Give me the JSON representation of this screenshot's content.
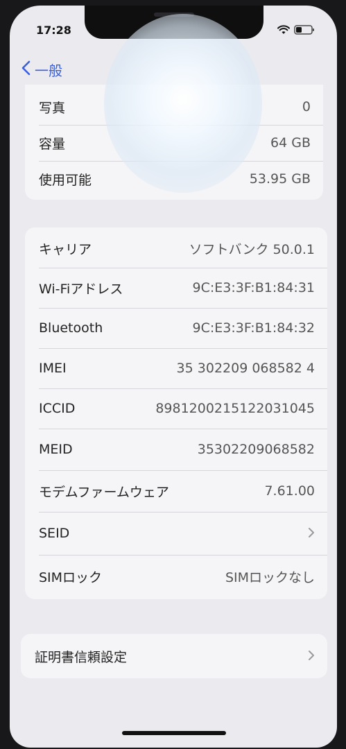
{
  "status_bar": {
    "time": "17:28"
  },
  "nav": {
    "back_label": "一般"
  },
  "storage_section": {
    "rows": [
      {
        "label": "写真",
        "value": "0"
      },
      {
        "label": "容量",
        "value": "64 GB"
      },
      {
        "label": "使用可能",
        "value": "53.95 GB"
      }
    ]
  },
  "network_section": {
    "rows": [
      {
        "label": "キャリア",
        "value": "ソフトバンク 50.0.1"
      },
      {
        "label": "Wi-Fiアドレス",
        "value": "9C:E3:3F:B1:84:31"
      },
      {
        "label": "Bluetooth",
        "value": "9C:E3:3F:B1:84:32"
      },
      {
        "label": "IMEI",
        "value": "35 302209 068582 4"
      },
      {
        "label": "ICCID",
        "value": "8981200215122031045"
      },
      {
        "label": "MEID",
        "value": "35302209068582"
      },
      {
        "label": "モデムファームウェア",
        "value": "7.61.00"
      },
      {
        "label": "SEID",
        "value": ""
      },
      {
        "label": "SIMロック",
        "value": "SIMロックなし"
      }
    ]
  },
  "certificate_section": {
    "label": "証明書信頼設定"
  }
}
